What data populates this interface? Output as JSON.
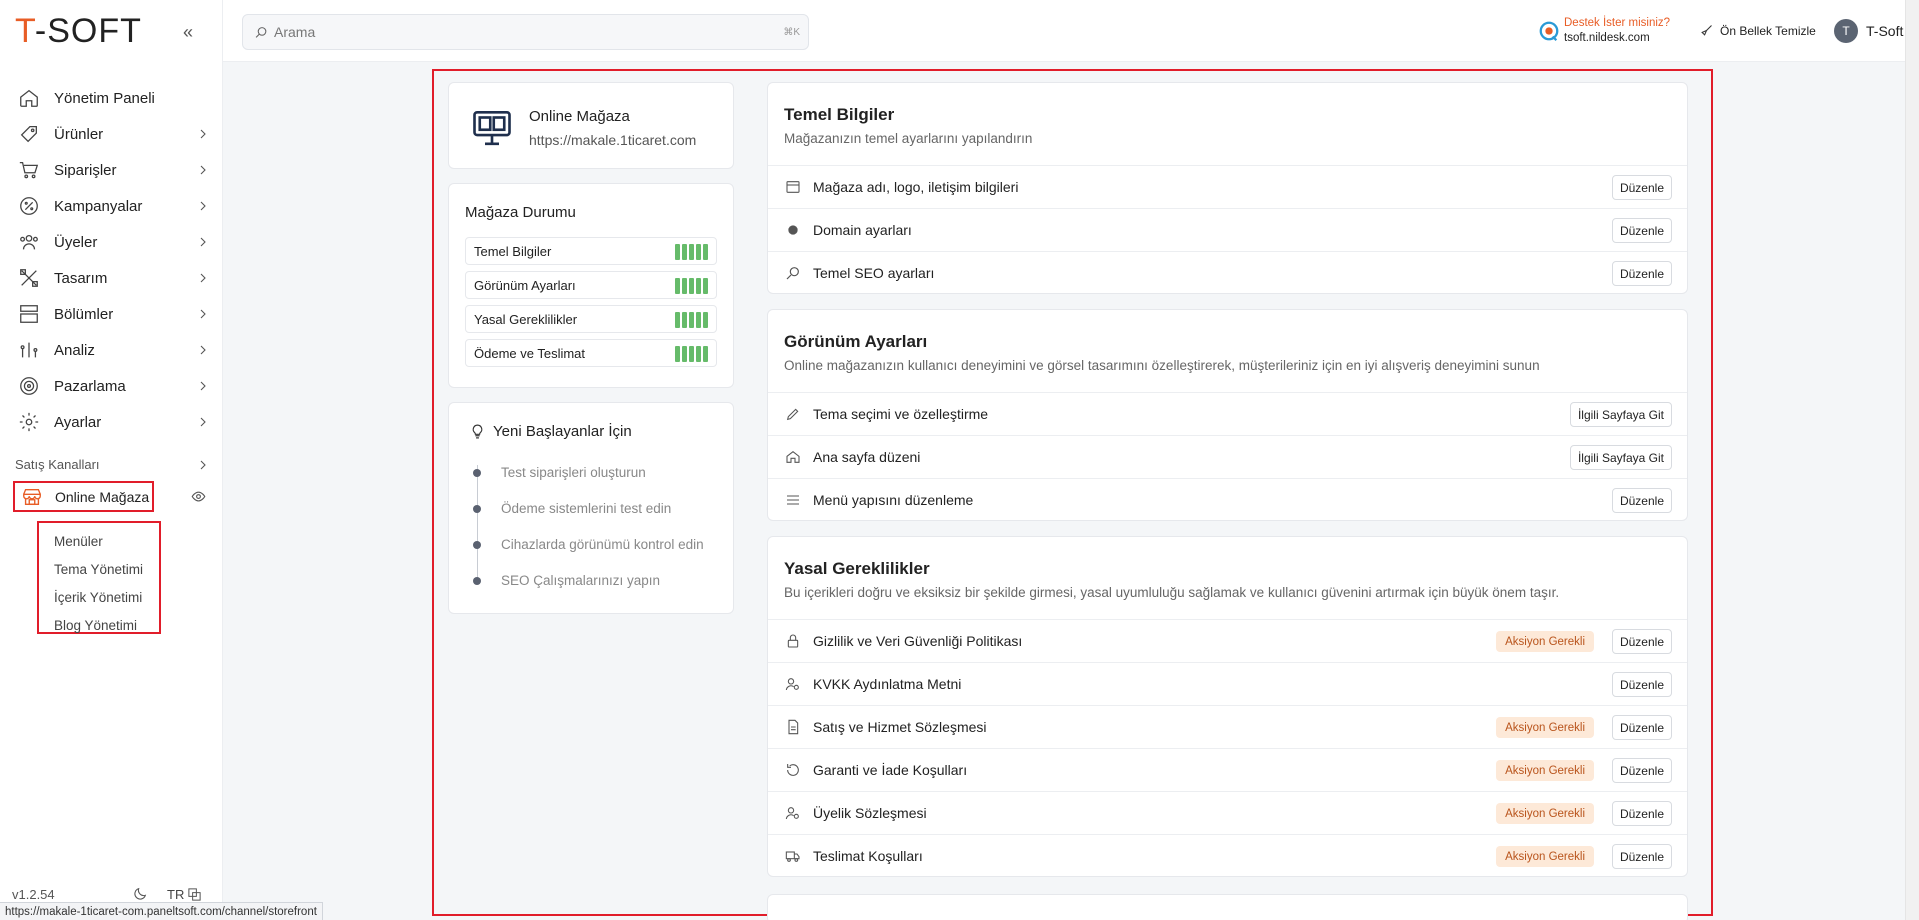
{
  "app": {
    "logo_prefix": "T",
    "logo_rest": "-SOFT",
    "version": "v1.2.54",
    "language": "TR"
  },
  "search": {
    "placeholder": "Arama",
    "shortcut": "⌘K"
  },
  "topbar": {
    "support_line1": "Destek İster misiniz?",
    "support_line2": "tsoft.nildesk.com",
    "cache_label": "Ön Bellek Temizle",
    "user_initial": "T",
    "user_name": "T-Soft"
  },
  "sidebar": {
    "items": [
      {
        "label": "Yönetim Paneli",
        "icon": "home-icon"
      },
      {
        "label": "Ürünler",
        "icon": "tag-icon"
      },
      {
        "label": "Siparişler",
        "icon": "cart-icon"
      },
      {
        "label": "Kampanyalar",
        "icon": "discount-icon"
      },
      {
        "label": "Üyeler",
        "icon": "users-icon"
      },
      {
        "label": "Tasarım",
        "icon": "design-icon"
      },
      {
        "label": "Bölümler",
        "icon": "sections-icon"
      },
      {
        "label": "Analiz",
        "icon": "analytics-icon"
      },
      {
        "label": "Pazarlama",
        "icon": "target-icon"
      },
      {
        "label": "Ayarlar",
        "icon": "gear-icon"
      }
    ],
    "section_title": "Satış Kanalları",
    "channel": "Online Mağaza",
    "subitems": [
      "Menüler",
      "Tema Yönetimi",
      "İçerik Yönetimi",
      "Blog Yönetimi"
    ]
  },
  "status_url": "https://makale-1ticaret-com.paneltsoft.com/channel/storefront",
  "store": {
    "name": "Online Mağaza",
    "url": "https://makale.1ticaret.com"
  },
  "store_status": {
    "title": "Mağaza Durumu",
    "items": [
      "Temel Bilgiler",
      "Görünüm Ayarları",
      "Yasal Gereklilikler",
      "Ödeme ve Teslimat"
    ]
  },
  "beginners": {
    "title": "Yeni Başlayanlar İçin",
    "steps": [
      "Test siparişleri oluşturun",
      "Ödeme sistemlerini test edin",
      "Cihazlarda görünümü kontrol edin",
      "SEO Çalışmalarınızı yapın"
    ]
  },
  "sections": {
    "basic": {
      "title": "Temel Bilgiler",
      "subtitle": "Mağazanızın temel ayarlarını yapılandırın",
      "rows": [
        {
          "label": "Mağaza adı, logo, iletişim bilgileri",
          "button": "Düzenle"
        },
        {
          "label": "Domain ayarları",
          "button": "Düzenle"
        },
        {
          "label": "Temel SEO ayarları",
          "button": "Düzenle"
        }
      ]
    },
    "appearance": {
      "title": "Görünüm Ayarları",
      "subtitle": "Online mağazanızın kullanıcı deneyimini ve görsel tasarımını özelleştirerek, müşterileriniz için en iyi alışveriş deneyimini sunun",
      "rows": [
        {
          "label": "Tema seçimi ve özelleştirme",
          "button": "İlgili Sayfaya Git"
        },
        {
          "label": "Ana sayfa düzeni",
          "button": "İlgili Sayfaya Git"
        },
        {
          "label": "Menü yapısını düzenleme",
          "button": "Düzenle"
        }
      ]
    },
    "legal": {
      "title": "Yasal Gereklilikler",
      "subtitle": "Bu içerikleri doğru ve eksiksiz bir şekilde girmesi, yasal uyumluluğu sağlamak ve kullanıcı güvenini artırmak için büyük önem taşır.",
      "badge": "Aksiyon Gerekli",
      "rows": [
        {
          "label": "Gizlilik ve Veri Güvenliği Politikası",
          "button": "Düzenle"
        },
        {
          "label": "KVKK Aydınlatma Metni",
          "button": "Düzenle"
        },
        {
          "label": "Satış ve Hizmet Sözleşmesi",
          "button": "Düzenle"
        },
        {
          "label": "Garanti ve İade Koşulları",
          "button": "Düzenle"
        },
        {
          "label": "Üyelik Sözleşmesi",
          "button": "Düzenle"
        },
        {
          "label": "Teslimat Koşulları",
          "button": "Düzenle"
        }
      ]
    }
  },
  "colors": {
    "brand": "#e85d26",
    "highlight": "#e11d2a",
    "status_green": "#66bb6a",
    "badge_bg": "#fde9d8",
    "badge_text": "#b9541c"
  }
}
